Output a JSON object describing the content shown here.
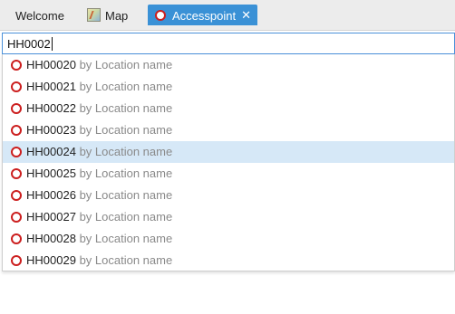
{
  "tabs": [
    {
      "label": "Welcome",
      "icon": null
    },
    {
      "label": "Map",
      "icon": "map-icon"
    },
    {
      "label": "Accesspoint",
      "icon": "accesspoint-ring-icon",
      "active": true,
      "close": "✕"
    }
  ],
  "search": {
    "value": "HH0002"
  },
  "results": [
    {
      "id": "HH00020",
      "location": "by Location name"
    },
    {
      "id": "HH00021",
      "location": "by Location name"
    },
    {
      "id": "HH00022",
      "location": "by Location name"
    },
    {
      "id": "HH00023",
      "location": "by Location name"
    },
    {
      "id": "HH00024",
      "location": "by Location name",
      "selected": true
    },
    {
      "id": "HH00025",
      "location": "by Location name"
    },
    {
      "id": "HH00026",
      "location": "by Location name"
    },
    {
      "id": "HH00027",
      "location": "by Location name"
    },
    {
      "id": "HH00028",
      "location": "by Location name"
    },
    {
      "id": "HH00029",
      "location": "by Location name"
    }
  ],
  "colors": {
    "accent": "#3a91d6",
    "selected_row": "#d6e8f7",
    "ring": "#cc1f1f"
  }
}
